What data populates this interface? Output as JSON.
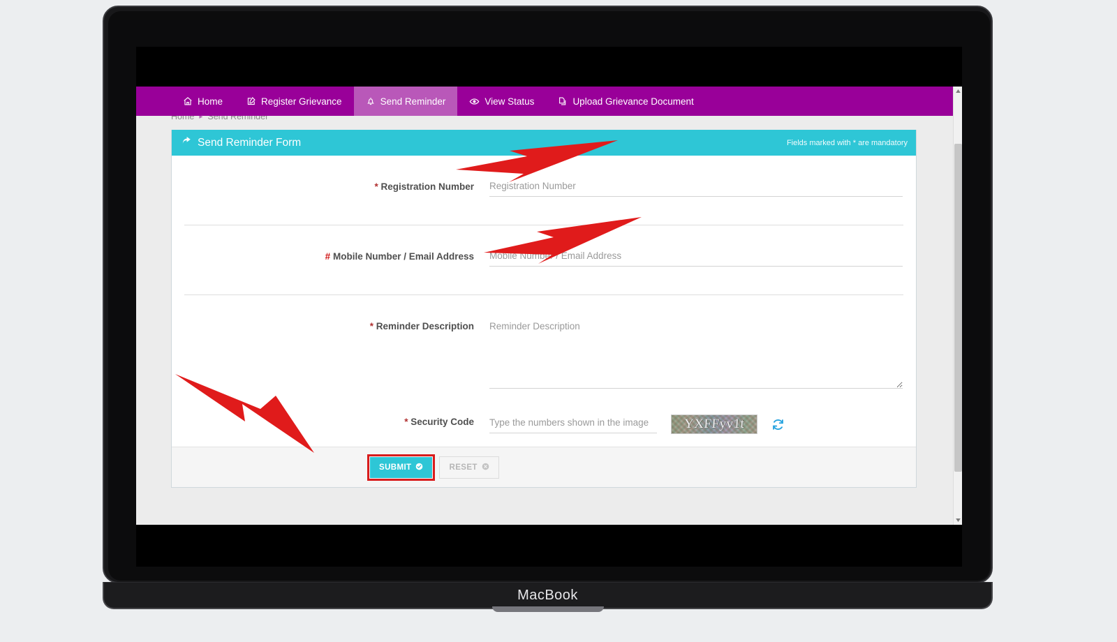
{
  "device": {
    "label": "MacBook"
  },
  "nav": {
    "background": "#990099",
    "active_background": "#b958b9",
    "items": [
      {
        "label": "Home",
        "icon": "home-icon",
        "active": false
      },
      {
        "label": "Register Grievance",
        "icon": "edit-square-icon",
        "active": false
      },
      {
        "label": "Send Reminder",
        "icon": "bell-icon",
        "active": true
      },
      {
        "label": "View Status",
        "icon": "eye-icon",
        "active": false
      },
      {
        "label": "Upload Grievance Document",
        "icon": "copy-document-icon",
        "active": false
      }
    ]
  },
  "breadcrumb": {
    "home": "Home",
    "separator": "▸",
    "current": "Send Reminder"
  },
  "panel": {
    "title": "Send Reminder Form",
    "title_icon": "share-arrow-icon",
    "mandatory_note_prefix": "Fields marked with",
    "mandatory_note_star": "*",
    "mandatory_note_suffix": "are mandatory",
    "header_color": "#2ec6d6"
  },
  "form": {
    "fields": [
      {
        "marker": "*",
        "marker_type": "star",
        "label": "Registration Number",
        "placeholder": "Registration Number",
        "value": "",
        "control": "input"
      },
      {
        "marker": "#",
        "marker_type": "hash",
        "label": "Mobile Number / Email Address",
        "placeholder": "Mobile Number / Email Address",
        "value": "",
        "control": "input"
      },
      {
        "marker": "*",
        "marker_type": "star",
        "label": "Reminder Description",
        "placeholder": "Reminder Description",
        "value": "",
        "control": "textarea"
      },
      {
        "marker": "*",
        "marker_type": "star",
        "label": "Security Code",
        "placeholder": "Type the numbers shown in the image",
        "value": "",
        "control": "captcha"
      }
    ],
    "captcha": {
      "text": "YXFFyv1t",
      "refresh_icon": "refresh-icon"
    },
    "buttons": {
      "submit": {
        "label": "SUBMIT",
        "icon": "check-circle-icon",
        "color": "#2ec6d6",
        "highlight_color": "#d81c1c"
      },
      "reset": {
        "label": "RESET",
        "icon": "times-circle-icon",
        "color": "#b6b6b6"
      }
    }
  },
  "annotations": {
    "color": "#e01b1b",
    "arrows": [
      {
        "name": "arrow-to-registration-number"
      },
      {
        "name": "arrow-to-mobile-email"
      },
      {
        "name": "arrow-to-submit-button"
      }
    ]
  },
  "scrollbar": {
    "up_arrow": "▲",
    "down_arrow": "▼"
  }
}
